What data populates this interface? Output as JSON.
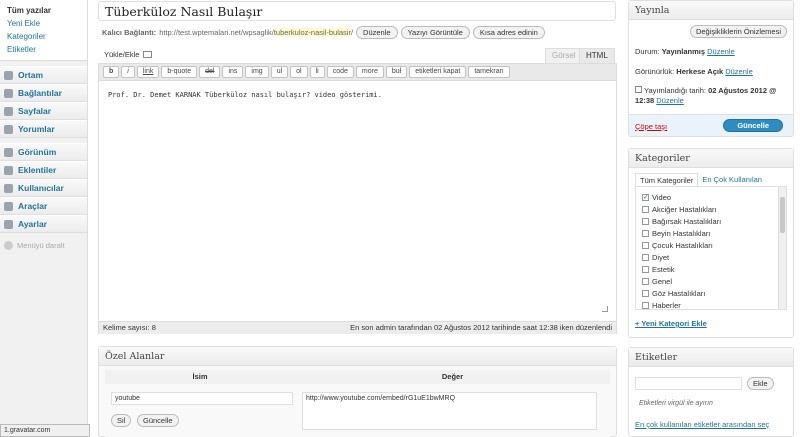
{
  "menu": {
    "submenu": [
      "Tüm yazılar",
      "Yeni Ekle",
      "Kategoriler",
      "Etiketler"
    ],
    "items": [
      {
        "label": "Ortam",
        "icon": "media-icon"
      },
      {
        "label": "Bağlantılar",
        "icon": "links-icon"
      },
      {
        "label": "Sayfalar",
        "icon": "pages-icon"
      },
      {
        "label": "Yorumlar",
        "icon": "comments-icon"
      },
      {
        "label": "Görünüm",
        "icon": "appearance-icon"
      },
      {
        "label": "Eklentiler",
        "icon": "plugins-icon"
      },
      {
        "label": "Kullanıcılar",
        "icon": "users-icon"
      },
      {
        "label": "Araçlar",
        "icon": "tools-icon"
      },
      {
        "label": "Ayarlar",
        "icon": "settings-icon"
      }
    ],
    "collapse": "Menüyü daralt"
  },
  "post": {
    "title": "Tüberküloz Nasıl Bulaşır",
    "permalink_label": "Kalıcı Bağlantı:",
    "permalink_base": "http://test.wptemalari.net/wpsaglik/",
    "permalink_slug": "tuberkuloz-nasil-bulasir",
    "permalink_end": "/",
    "edit_btn": "Düzenle",
    "view_btn": "Yazıyı Görüntüle",
    "short_btn": "Kısa adres edinin",
    "upload_label": "Yükle/Ekle",
    "tab_visual": "Görsel",
    "tab_html": "HTML",
    "quicktags": [
      "b",
      "i",
      "link",
      "b-quote",
      "del",
      "ins",
      "img",
      "ul",
      "ol",
      "li",
      "code",
      "more",
      "buł",
      "etiketleri kapat",
      "tamekran"
    ],
    "content": "Prof. Dr. Demet KARNAK Tüberküloz nasıl bulaşır? video gösterimi.",
    "word_count": "Kelime sayısı: 8",
    "last_edit": "En son admin tarafından 02 Ağustos 2012 tarihinde saat 12:38 iken düzenlendi"
  },
  "custom_fields": {
    "title": "Özel Alanlar",
    "col_name": "İsim",
    "col_value": "Değer",
    "key": "youtube",
    "value": "http://www.youtube.com/embed/rG1uE1bwMRQ",
    "delete_btn": "Sil",
    "update_btn": "Güncelle"
  },
  "publish": {
    "title": "Yayınla",
    "preview_btn": "Değişikliklerin Önizlemesi",
    "status_label": "Durum:",
    "status_value": "Yayınlanmış",
    "visibility_label": "Görünürlük:",
    "visibility_value": "Herkese Açık",
    "edit_link": "Düzenle",
    "date_label": "Yayımlandığı tarih:",
    "date_value": "02 Ağustos 2012 @",
    "time_value": "12:38",
    "trash": "Çöpe taşı",
    "update_btn": "Güncelle"
  },
  "categories": {
    "title": "Kategoriler",
    "tab_all": "Tüm Kategoriler",
    "tab_popular": "En Çok Kullanılan",
    "items": [
      {
        "label": "Video",
        "checked": "✓"
      },
      {
        "label": "Akciğer Hastalıkları",
        "checked": ""
      },
      {
        "label": "Bağırsak Hastalıkları",
        "checked": ""
      },
      {
        "label": "Beyin Hastalıkları",
        "checked": ""
      },
      {
        "label": "Çocuk Hastalıkları",
        "checked": ""
      },
      {
        "label": "Diyet",
        "checked": ""
      },
      {
        "label": "Estetik",
        "checked": ""
      },
      {
        "label": "Genel",
        "checked": ""
      },
      {
        "label": "Göz Hastalıkları",
        "checked": ""
      },
      {
        "label": "Haberler",
        "checked": ""
      }
    ],
    "add_new": "+ Yeni Kategori Ekle"
  },
  "tags": {
    "title": "Etiketler",
    "add_btn": "Ekle",
    "hint": "Etiketleri virgül ile ayırın",
    "popular_link": "En çok kullanılan etiketler arasından seç"
  },
  "browser_status": "1.gravatar.com bekleniyor..."
}
